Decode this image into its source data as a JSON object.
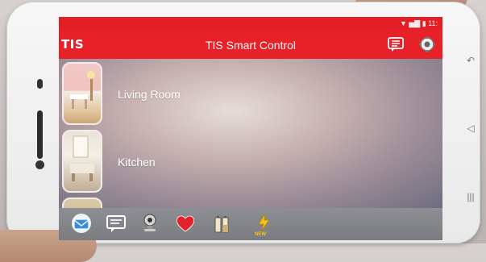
{
  "app": {
    "logo": "TIS",
    "title": "TIS Smart Control"
  },
  "statusbar": {
    "indicators": "▼ ▅▇ ▮ 11:"
  },
  "rooms": [
    {
      "label": "Living Room"
    },
    {
      "label": "Kitchen"
    }
  ],
  "colors": {
    "accent": "#e82028",
    "bottombar": "#818387"
  },
  "bottom_nav": [
    {
      "icon": "mail-icon"
    },
    {
      "icon": "message-icon"
    },
    {
      "icon": "camera-icon"
    },
    {
      "icon": "heart-icon"
    },
    {
      "icon": "battery-icon"
    },
    {
      "icon": "energy-new-icon",
      "badge": "NEW"
    }
  ],
  "device_nav": {
    "back": "↶",
    "home": "◁",
    "menu": "|||"
  }
}
